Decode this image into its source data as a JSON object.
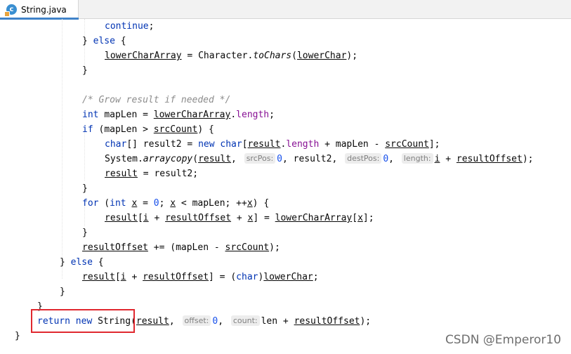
{
  "tab": {
    "icon_letter": "c",
    "file_name": "String.java"
  },
  "code": {
    "continue": "continue",
    "else": "else",
    "lowerCharArray": "lowerCharArray",
    "Character": "Character",
    "toChars": "toChars",
    "lowerChar": "lowerChar",
    "comment_grow": "/* Grow result if needed */",
    "int": "int",
    "mapLen": "mapLen",
    "length": "length",
    "if": "if",
    "srcCount": "srcCount",
    "char": "char",
    "result2": "result2",
    "new": "new",
    "result": "result",
    "System": "System",
    "arraycopy": "arraycopy",
    "hint_srcPos": "srcPos:",
    "hint_destPos": "destPos:",
    "hint_length": "length:",
    "zero": "0",
    "i": "i",
    "resultOffset": "resultOffset",
    "for": "for",
    "x": "x",
    "return": "return",
    "String": "String",
    "hint_offset": "offset:",
    "hint_count": "count:",
    "len": "len"
  },
  "watermark": "CSDN @Emperor10"
}
